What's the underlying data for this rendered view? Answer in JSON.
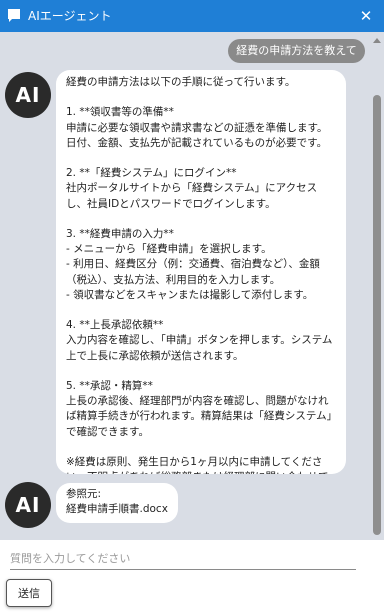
{
  "header": {
    "title": "AIエージェント",
    "close_label": "✕",
    "background": "#1f7fd6"
  },
  "icons": {
    "chat": "chat-bubble-icon",
    "close": "close-icon"
  },
  "messages": {
    "user_text": "経費の申請方法を教えて",
    "avatar_label": "AI",
    "ai_answer": "経費の申請方法は以下の手順に従って行います。\n\n1. **領収書等の準備**\n申請に必要な領収書や請求書などの証憑を準備します。日付、金額、支払先が記載されているものが必要です。\n\n2. **「経費システム」にログイン**\n社内ポータルサイトから「経費システム」にアクセスし、社員IDとパスワードでログインします。\n\n3. **経費申請の入力**\n- メニューから「経費申請」を選択します。\n- 利用日、経費区分（例：交通費、宿泊費など）、金額（税込）、支払方法、利用目的を入力します。\n- 領収書などをスキャンまたは撮影して添付します。\n\n4. **上長承認依頼**\n入力内容を確認し、「申請」ボタンを押します。システム上で上長に承認依頼が送信されます。\n\n5. **承認・精算**\n上長の承認後、経理部門が内容を確認し、問題がなければ精算手続きが行われます。精算結果は「経費システム」で確認できます。\n\n※経費は原則、発生日から1ヶ月以内に申請してください。不明点があれば総務部または経理部に問い合わせてください。",
    "reference": "参照元:\n経費申請手順書.docx"
  },
  "input": {
    "value": "",
    "placeholder": "質問を入力してください",
    "send_label": "送信"
  }
}
